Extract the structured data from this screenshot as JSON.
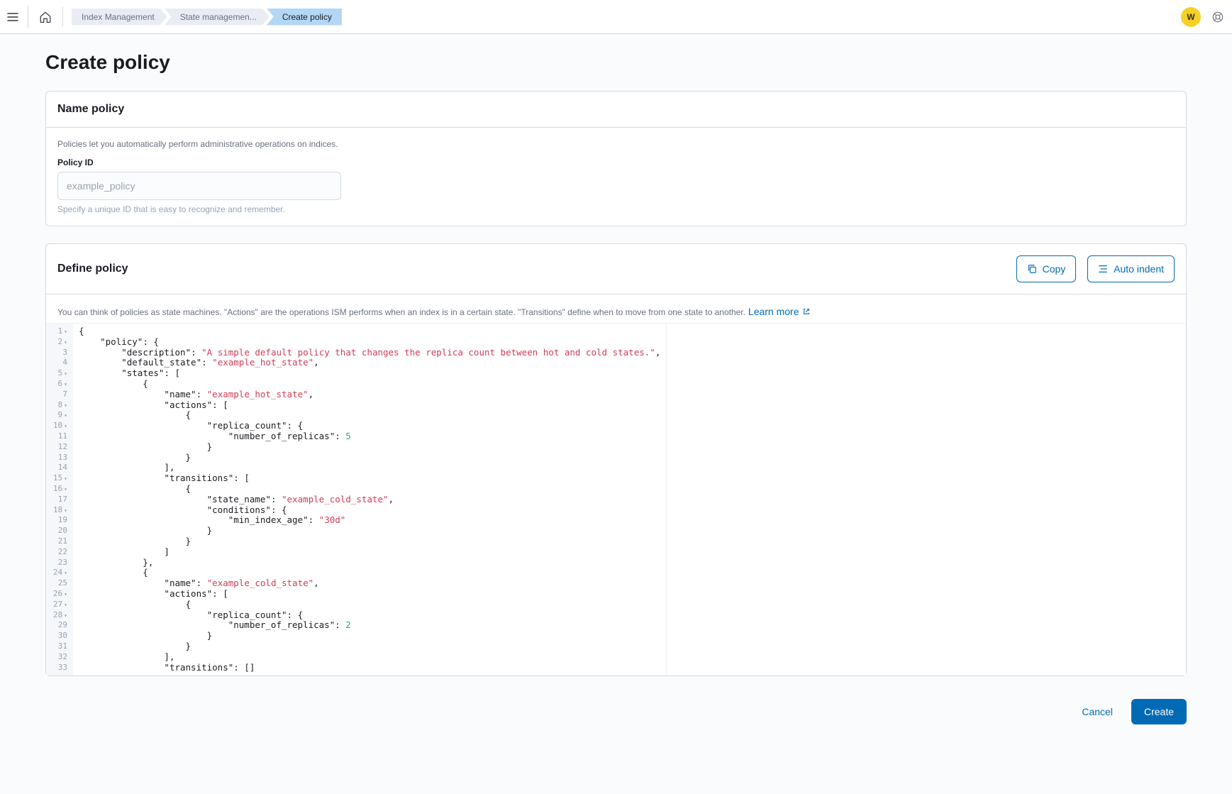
{
  "header": {
    "avatar_initial": "W",
    "breadcrumbs": [
      "Index Management",
      "State managemen...",
      "Create policy"
    ]
  },
  "page": {
    "title": "Create policy"
  },
  "name_panel": {
    "title": "Name policy",
    "help": "Policies let you automatically perform administrative operations on indices.",
    "field_label": "Policy ID",
    "placeholder": "example_policy",
    "value": "",
    "hint": "Specify a unique ID that is easy to recognize and remember."
  },
  "define_panel": {
    "title": "Define policy",
    "copy_label": "Copy",
    "indent_label": "Auto indent",
    "help": "You can think of policies as state machines. \"Actions\" are the operations ISM performs when an index is in a certain state. \"Transitions\" define when to move from one state to another.",
    "learn_more": "Learn more"
  },
  "code": {
    "gutter": [
      {
        "n": "1",
        "f": true
      },
      {
        "n": "2",
        "f": true
      },
      {
        "n": "3",
        "f": false
      },
      {
        "n": "4",
        "f": false
      },
      {
        "n": "5",
        "f": true
      },
      {
        "n": "6",
        "f": true
      },
      {
        "n": "7",
        "f": false
      },
      {
        "n": "8",
        "f": true
      },
      {
        "n": "9",
        "f": true
      },
      {
        "n": "10",
        "f": true
      },
      {
        "n": "11",
        "f": false
      },
      {
        "n": "12",
        "f": false
      },
      {
        "n": "13",
        "f": false
      },
      {
        "n": "14",
        "f": false
      },
      {
        "n": "15",
        "f": true
      },
      {
        "n": "16",
        "f": true
      },
      {
        "n": "17",
        "f": false
      },
      {
        "n": "18",
        "f": true
      },
      {
        "n": "19",
        "f": false
      },
      {
        "n": "20",
        "f": false
      },
      {
        "n": "21",
        "f": false
      },
      {
        "n": "22",
        "f": false
      },
      {
        "n": "23",
        "f": false
      },
      {
        "n": "24",
        "f": true
      },
      {
        "n": "25",
        "f": false
      },
      {
        "n": "26",
        "f": true
      },
      {
        "n": "27",
        "f": true
      },
      {
        "n": "28",
        "f": true
      },
      {
        "n": "29",
        "f": false
      },
      {
        "n": "30",
        "f": false
      },
      {
        "n": "31",
        "f": false
      },
      {
        "n": "32",
        "f": false
      },
      {
        "n": "33",
        "f": false
      }
    ],
    "lines": [
      [
        [
          "pun",
          "{"
        ]
      ],
      [
        [
          "pun",
          "    "
        ],
        [
          "key",
          "\"policy\""
        ],
        [
          "pun",
          ": {"
        ]
      ],
      [
        [
          "pun",
          "        "
        ],
        [
          "key",
          "\"description\""
        ],
        [
          "pun",
          ": "
        ],
        [
          "str",
          "\"A simple default policy that changes the replica count between hot and cold states.\""
        ],
        [
          "pun",
          ","
        ]
      ],
      [
        [
          "pun",
          "        "
        ],
        [
          "key",
          "\"default_state\""
        ],
        [
          "pun",
          ": "
        ],
        [
          "str",
          "\"example_hot_state\""
        ],
        [
          "pun",
          ","
        ]
      ],
      [
        [
          "pun",
          "        "
        ],
        [
          "key",
          "\"states\""
        ],
        [
          "pun",
          ": ["
        ]
      ],
      [
        [
          "pun",
          "            {"
        ]
      ],
      [
        [
          "pun",
          "                "
        ],
        [
          "key",
          "\"name\""
        ],
        [
          "pun",
          ": "
        ],
        [
          "str",
          "\"example_hot_state\""
        ],
        [
          "pun",
          ","
        ]
      ],
      [
        [
          "pun",
          "                "
        ],
        [
          "key",
          "\"actions\""
        ],
        [
          "pun",
          ": ["
        ]
      ],
      [
        [
          "pun",
          "                    {"
        ]
      ],
      [
        [
          "pun",
          "                        "
        ],
        [
          "key",
          "\"replica_count\""
        ],
        [
          "pun",
          ": {"
        ]
      ],
      [
        [
          "pun",
          "                            "
        ],
        [
          "key",
          "\"number_of_replicas\""
        ],
        [
          "pun",
          ": "
        ],
        [
          "num",
          "5"
        ]
      ],
      [
        [
          "pun",
          "                        }"
        ]
      ],
      [
        [
          "pun",
          "                    }"
        ]
      ],
      [
        [
          "pun",
          "                ],"
        ]
      ],
      [
        [
          "pun",
          "                "
        ],
        [
          "key",
          "\"transitions\""
        ],
        [
          "pun",
          ": ["
        ]
      ],
      [
        [
          "pun",
          "                    {"
        ]
      ],
      [
        [
          "pun",
          "                        "
        ],
        [
          "key",
          "\"state_name\""
        ],
        [
          "pun",
          ": "
        ],
        [
          "str",
          "\"example_cold_state\""
        ],
        [
          "pun",
          ","
        ]
      ],
      [
        [
          "pun",
          "                        "
        ],
        [
          "key",
          "\"conditions\""
        ],
        [
          "pun",
          ": {"
        ]
      ],
      [
        [
          "pun",
          "                            "
        ],
        [
          "key",
          "\"min_index_age\""
        ],
        [
          "pun",
          ": "
        ],
        [
          "str",
          "\"30d\""
        ]
      ],
      [
        [
          "pun",
          "                        }"
        ]
      ],
      [
        [
          "pun",
          "                    }"
        ]
      ],
      [
        [
          "pun",
          "                ]"
        ]
      ],
      [
        [
          "pun",
          "            },"
        ]
      ],
      [
        [
          "pun",
          "            {"
        ]
      ],
      [
        [
          "pun",
          "                "
        ],
        [
          "key",
          "\"name\""
        ],
        [
          "pun",
          ": "
        ],
        [
          "str",
          "\"example_cold_state\""
        ],
        [
          "pun",
          ","
        ]
      ],
      [
        [
          "pun",
          "                "
        ],
        [
          "key",
          "\"actions\""
        ],
        [
          "pun",
          ": ["
        ]
      ],
      [
        [
          "pun",
          "                    {"
        ]
      ],
      [
        [
          "pun",
          "                        "
        ],
        [
          "key",
          "\"replica_count\""
        ],
        [
          "pun",
          ": {"
        ]
      ],
      [
        [
          "pun",
          "                            "
        ],
        [
          "key",
          "\"number_of_replicas\""
        ],
        [
          "pun",
          ": "
        ],
        [
          "num",
          "2"
        ]
      ],
      [
        [
          "pun",
          "                        }"
        ]
      ],
      [
        [
          "pun",
          "                    }"
        ]
      ],
      [
        [
          "pun",
          "                ],"
        ]
      ],
      [
        [
          "pun",
          "                "
        ],
        [
          "key",
          "\"transitions\""
        ],
        [
          "pun",
          ": []"
        ]
      ]
    ]
  },
  "footer": {
    "cancel": "Cancel",
    "create": "Create"
  }
}
